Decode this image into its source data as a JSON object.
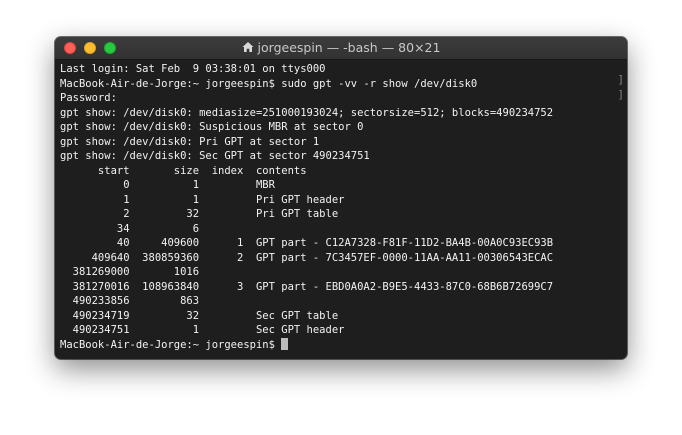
{
  "window": {
    "title": "jorgeespin — -bash — 80×21"
  },
  "terminal": {
    "lines": [
      "Last login: Sat Feb  9 03:38:01 on ttys000",
      "MacBook-Air-de-Jorge:~ jorgeespin$ sudo gpt -vv -r show /dev/disk0",
      "Password:",
      "gpt show: /dev/disk0: mediasize=251000193024; sectorsize=512; blocks=490234752",
      "gpt show: /dev/disk0: Suspicious MBR at sector 0",
      "gpt show: /dev/disk0: Pri GPT at sector 1",
      "gpt show: /dev/disk0: Sec GPT at sector 490234751",
      "      start       size  index  contents",
      "          0          1         MBR",
      "          1          1         Pri GPT header",
      "          2         32         Pri GPT table",
      "         34          6",
      "         40     409600      1  GPT part - C12A7328-F81F-11D2-BA4B-00A0C93EC93B",
      "     409640  380859360      2  GPT part - 7C3457EF-0000-11AA-AA11-00306543ECAC",
      "  381269000       1016",
      "  381270016  108963840      3  GPT part - EBD0A0A2-B9E5-4433-87C0-68B6B72699C7",
      "  490233856        863",
      "  490234719         32         Sec GPT table",
      "  490234751          1         Sec GPT header"
    ],
    "prompt": "MacBook-Air-de-Jorge:~ jorgeespin$ "
  },
  "colors": {
    "background": "#1e1e1e",
    "text": "#f2f2f2",
    "close": "#fe5f57",
    "minimize": "#febc2e",
    "maximize": "#28c840"
  }
}
